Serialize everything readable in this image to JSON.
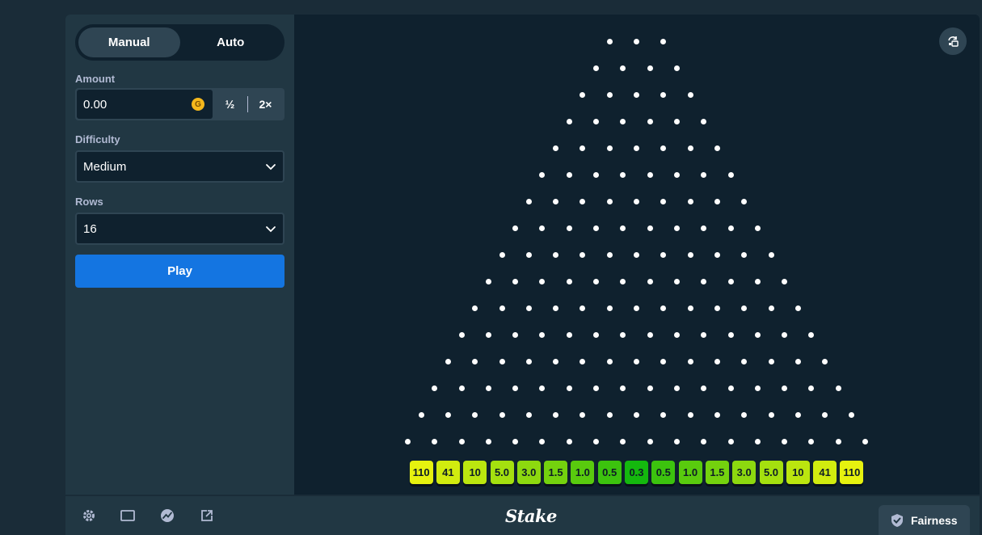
{
  "sidebar": {
    "mode_manual": "Manual",
    "mode_auto": "Auto",
    "amount_label": "Amount",
    "amount_value": "0.00",
    "coin_letter": "G",
    "half_label": "½",
    "double_label": "2×",
    "difficulty_label": "Difficulty",
    "difficulty_value": "Medium",
    "rows_label": "Rows",
    "rows_value": "16",
    "play_label": "Play"
  },
  "board": {
    "rows": 16,
    "multipliers": [
      "110",
      "41",
      "10",
      "5.0",
      "3.0",
      "1.5",
      "1.0",
      "0.5",
      "0.3",
      "0.5",
      "1.0",
      "1.5",
      "3.0",
      "5.0",
      "10",
      "41",
      "110"
    ],
    "colors": {
      "peg": "#ffffff",
      "bucket_edge": "#e6f20f",
      "bucket_center": "#14b80e"
    }
  },
  "footer": {
    "logo": "Stake",
    "fairness_label": "Fairness",
    "icons": [
      "gear-icon",
      "window-icon",
      "chart-icon",
      "popout-icon"
    ]
  }
}
